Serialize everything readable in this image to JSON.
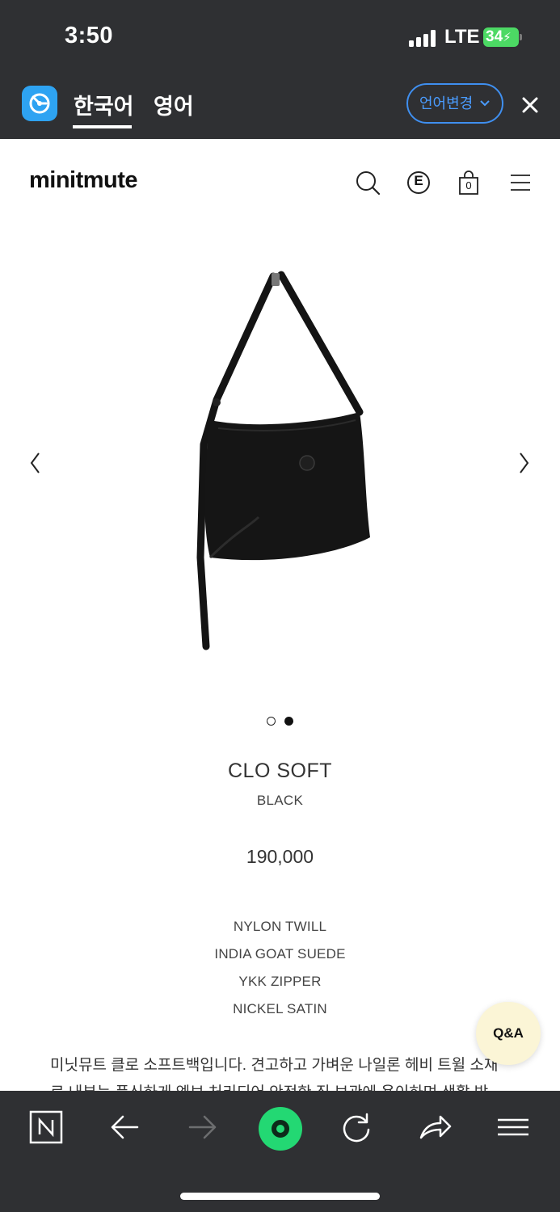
{
  "status_bar": {
    "time": "3:50",
    "network": "LTE",
    "battery": "34",
    "icons": [
      "signal-icon",
      "battery-icon"
    ]
  },
  "translate_bar": {
    "tabs": [
      {
        "label": "한국어",
        "active": true
      },
      {
        "label": "영어",
        "active": false
      }
    ],
    "change_language_label": "언어변경",
    "icons": [
      "papago-icon",
      "chevron-down-icon",
      "close-icon"
    ],
    "accent_color": "#3f8ff0"
  },
  "site_header": {
    "logo": "minitmute",
    "language_badge": "E",
    "cart_count": "0",
    "icons": [
      "search-icon",
      "language-icon",
      "cart-icon",
      "menu-icon"
    ]
  },
  "gallery": {
    "slide_count": 2,
    "active_slide": 2,
    "icons": [
      "chevron-left-icon",
      "chevron-right-icon"
    ]
  },
  "product": {
    "name": "CLO SOFT",
    "color": "BLACK",
    "price": "190,000",
    "materials": [
      "NYLON TWILL",
      "INDIA GOAT SUEDE",
      "YKK ZIPPER",
      "NICKEL SATIN"
    ],
    "description": "미닛뮤트 클로 소프트백입니다. 견고하고 가벼운 나일론 헤비 트윌 소재로 내부는 푹신하게 엠보 처리되어 안전한 짐 보관에 용이하며 생활 방"
  },
  "qa_button": {
    "label": "Q&A"
  },
  "browser_toolbar": {
    "icons": [
      "naver-icon",
      "back-arrow-icon",
      "forward-arrow-icon",
      "green-dot-icon",
      "refresh-icon",
      "share-icon",
      "menu-icon"
    ],
    "highlight_color": "#23d873"
  }
}
